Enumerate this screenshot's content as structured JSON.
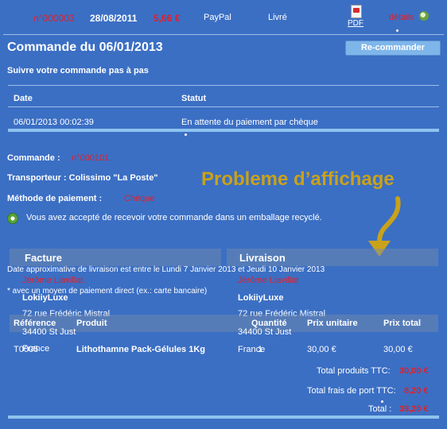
{
  "order_row": {
    "ref": "n°000003",
    "date": "28/08/2011",
    "amount": "5,66 €",
    "payment": "PayPal",
    "status": "Livré",
    "pdf_label": "PDF",
    "details_label": "détails"
  },
  "header": {
    "title": "Commande du 06/01/2013",
    "reorder_label": "Re-commander",
    "track_label": "Suivre votre commande pas à pas"
  },
  "status_table": {
    "columns": [
      "Date",
      "Statut"
    ],
    "rows": [
      {
        "date": "06/01/2013 00:02:39",
        "status": "En attente du paiement par chèque"
      }
    ]
  },
  "order_info": {
    "order_label": "Commande :",
    "order_value": "n°000101",
    "carrier_label": "Transporteur : Colissimo \"La Poste\"",
    "payment_label": "Méthode de paiement :",
    "payment_value": "Chèque",
    "recycle_note": "Vous avez accepté de recevoir votre commande dans un emballage recyclé."
  },
  "annotation": "Probleme d’affichage",
  "invoice": {
    "title": "Facture",
    "name": "Jérôme Liavillat",
    "company": "LokiiyLuxe",
    "street": "72 rue Frédéric Mistral",
    "city": "34400 St Just",
    "country": "France"
  },
  "delivery": {
    "title": "Livraison",
    "name": "Jérôme Liavillat",
    "company": "LokiiyLuxe",
    "street": "72 rue Frédéric Mistral",
    "city": "34400 St Just",
    "country": "France"
  },
  "overlap_text": {
    "delivery_date": "Date approximative de livraison est entre le Lundi 7 Janvier 2013 et Jeudi 10 Janvier 2013",
    "payment_note": "* avec un moyen de paiement direct (ex.: carte bancaire)"
  },
  "products": {
    "columns": [
      "Référence",
      "Produit",
      "Quantité",
      "Prix unitaire",
      "Prix total"
    ],
    "rows": [
      {
        "ref": "T0005",
        "product": "Lithothamne Pack-Gélules 1Kg",
        "qty": "1",
        "unit": "30,00 €",
        "total": "30,00 €"
      }
    ]
  },
  "totals": {
    "products_label": "Total produits TTC:",
    "products_value": "30,00 €",
    "shipping_label": "Total frais de port TTC:",
    "shipping_value": "8,20 €",
    "total_label": "Total :",
    "total_value": "38,20 €"
  },
  "colors": {
    "background": "#3b6fc4",
    "accent_red": "#e0202a",
    "annotation": "#c9a21a",
    "bar": "#8ec3f0"
  }
}
